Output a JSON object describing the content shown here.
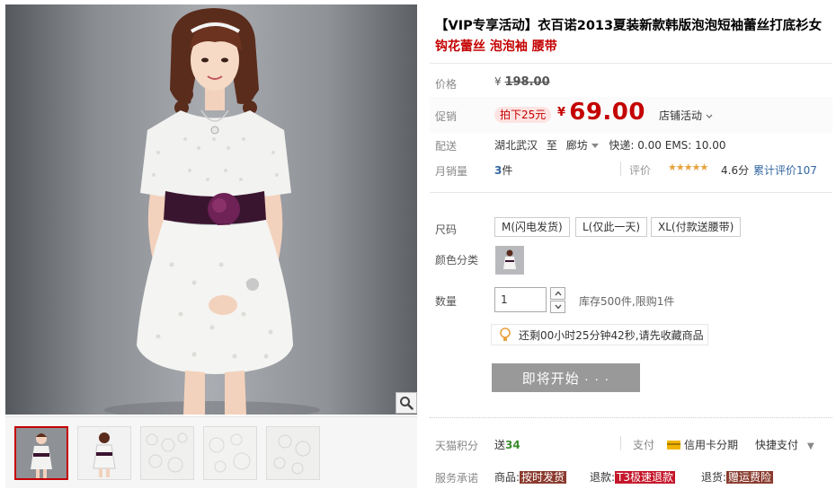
{
  "product": {
    "title": "【VIP专享活动】衣百诺2013夏装新款韩版泡泡短袖蕾丝打底衫女",
    "subtitle": "钩花蕾丝 泡泡袖 腰带"
  },
  "price": {
    "label": "价格",
    "currency": "¥",
    "original": "198.00"
  },
  "promo": {
    "label": "促销",
    "discount_tag": "拍下25元",
    "currency": "¥",
    "sale_price": "69.00",
    "shop_activity": "店铺活动"
  },
  "shipping": {
    "label": "配送",
    "origin": "湖北武汉",
    "to": "至",
    "destination": "廊坊",
    "fees": "快递: 0.00 EMS: 10.00"
  },
  "sales": {
    "label": "月销量",
    "count": "3",
    "unit": "件"
  },
  "rating": {
    "label": "评价",
    "stars": "★★★★★",
    "score": "4.6分",
    "review_link": "累计评价107",
    "value": 4.6
  },
  "size": {
    "label": "尺码",
    "options": [
      "M(闪电发货)",
      "L(仅此一天)",
      "XL(付款送腰带)"
    ]
  },
  "color": {
    "label": "颜色分类"
  },
  "quantity": {
    "label": "数量",
    "value": "1",
    "stock": "库存500件,限购1件"
  },
  "countdown": {
    "text": "还剩00小时25分钟42秒,请先收藏商品"
  },
  "buy": {
    "label": "即将开始 · · ·"
  },
  "points": {
    "label": "天猫积分",
    "prefix": "送",
    "value": "34"
  },
  "payment": {
    "label": "支付",
    "credit": "信用卡分期",
    "quick": "快捷支付"
  },
  "service": {
    "label": "服务承诺",
    "items": [
      {
        "prefix": "商品:",
        "tag": "按时发货"
      },
      {
        "prefix": "退款:",
        "tag": "T3极速退款"
      },
      {
        "prefix": "退货:",
        "tag": "赠运费险"
      }
    ]
  },
  "colors": {
    "price_red": "#c40000",
    "link_blue": "#3366a0",
    "disabled_button": "#999999",
    "points_green": "#3a8c2e"
  }
}
